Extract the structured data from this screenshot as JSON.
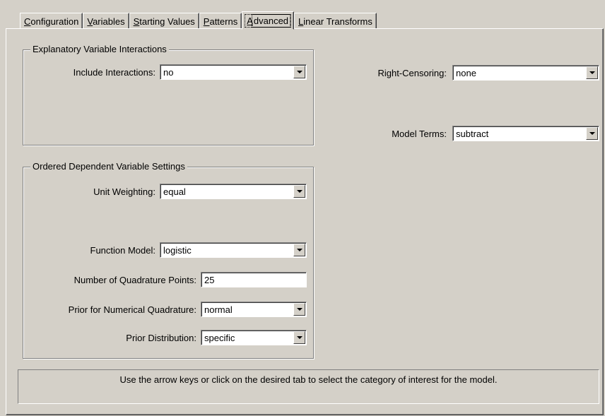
{
  "tabs": [
    {
      "accel": "C",
      "rest": "onfiguration"
    },
    {
      "accel": "V",
      "rest": "ariables"
    },
    {
      "accel": "S",
      "rest": "tarting Values"
    },
    {
      "accel": "P",
      "rest": "atterns"
    },
    {
      "accel": "A",
      "rest": "dvanced"
    },
    {
      "accel": "L",
      "rest": "inear Transforms"
    }
  ],
  "active_tab": "Advanced",
  "interactions_group": {
    "title": "Explanatory Variable Interactions",
    "include_label": "Include Interactions:",
    "include_value": "no"
  },
  "right": {
    "censoring_label": "Right-Censoring:",
    "censoring_value": "none",
    "terms_label": "Model Terms:",
    "terms_value": "subtract"
  },
  "ordered_group": {
    "title": "Ordered Dependent Variable Settings",
    "unit_weighting_label": "Unit Weighting:",
    "unit_weighting_value": "equal",
    "function_model_label": "Function Model:",
    "function_model_value": "logistic",
    "quad_points_label": "Number of Quadrature Points:",
    "quad_points_value": "25",
    "prior_quad_label": "Prior for Numerical Quadrature:",
    "prior_quad_value": "normal",
    "prior_dist_label": "Prior Distribution:",
    "prior_dist_value": "specific"
  },
  "status_text": "Use the arrow keys or click on the desired tab to select the category of interest for the model."
}
